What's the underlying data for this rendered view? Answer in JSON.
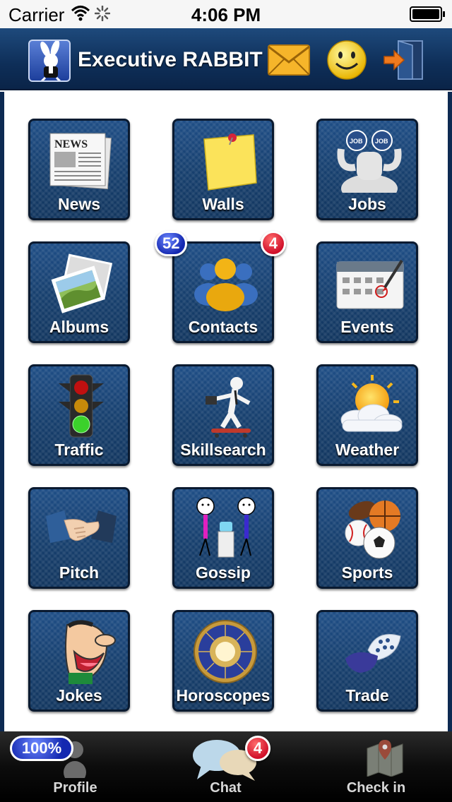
{
  "status_bar": {
    "carrier": "Carrier",
    "time": "4:06 PM"
  },
  "header": {
    "title": "Executive RABBIT",
    "icons": [
      "rabbit-logo-icon",
      "mail-icon",
      "smiley-icon",
      "logout-icon"
    ]
  },
  "tiles": [
    {
      "label": "News",
      "icon": "newspaper-icon"
    },
    {
      "label": "Walls",
      "icon": "sticky-note-icon"
    },
    {
      "label": "Jobs",
      "icon": "binoculars-icon"
    },
    {
      "label": "Albums",
      "icon": "photos-icon"
    },
    {
      "label": "Contacts",
      "icon": "people-icon",
      "badge_left": "52",
      "badge_right": "4"
    },
    {
      "label": "Events",
      "icon": "calendar-icon"
    },
    {
      "label": "Traffic",
      "icon": "traffic-light-icon"
    },
    {
      "label": "Skillsearch",
      "icon": "skateboard-figure-icon"
    },
    {
      "label": "Weather",
      "icon": "sun-cloud-icon"
    },
    {
      "label": "Pitch",
      "icon": "handshake-icon"
    },
    {
      "label": "Gossip",
      "icon": "gossip-figures-icon"
    },
    {
      "label": "Sports",
      "icon": "sports-balls-icon"
    },
    {
      "label": "Jokes",
      "icon": "laughing-face-icon"
    },
    {
      "label": "Horoscopes",
      "icon": "zodiac-wheel-icon"
    },
    {
      "label": "Trade",
      "icon": "trade-icon"
    }
  ],
  "tabbar": {
    "profile": {
      "label": "Profile",
      "badge": "100%"
    },
    "chat": {
      "label": "Chat",
      "badge": "4"
    },
    "checkin": {
      "label": "Check in"
    }
  },
  "colors": {
    "header_dark": "#0e2e58",
    "tile_blue": "#17406f",
    "badge_red": "#d0102a",
    "badge_blue": "#1428b0"
  }
}
